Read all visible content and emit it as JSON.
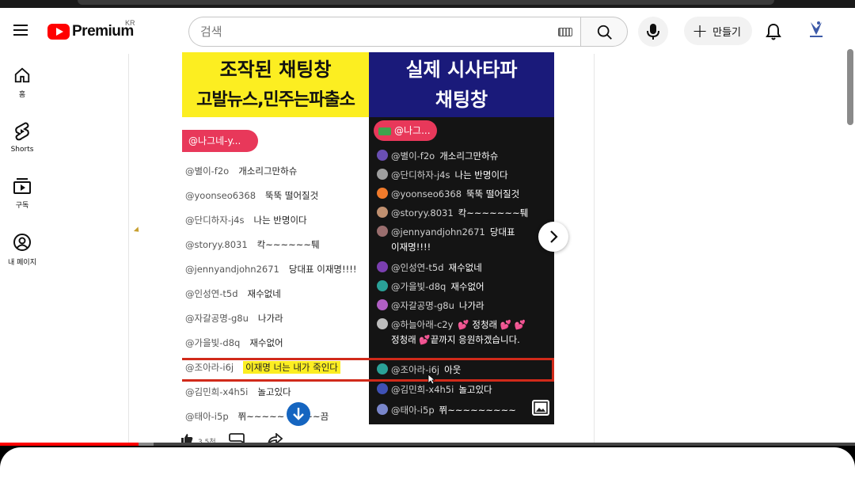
{
  "header": {
    "logo_text": "Premium",
    "region": "KR",
    "search_placeholder": "검색",
    "create_label": "만들기"
  },
  "nav": [
    {
      "label": "홈",
      "icon": "home-icon"
    },
    {
      "label": "Shorts",
      "icon": "shorts-icon"
    },
    {
      "label": "구독",
      "icon": "subscriptions-icon"
    },
    {
      "label": "내 페이지",
      "icon": "account-icon"
    }
  ],
  "post": {
    "left_title_1": "조작된 채팅창",
    "left_title_2": "고발뉴스,민주는파출소",
    "right_title_1": "실제 시사타파",
    "right_title_2": "채팅창",
    "left_pill": "@나그네-y...",
    "right_pill": "@나그...",
    "left_chat": [
      {
        "user": "@별이-f2o",
        "msg": "개소리그만하슈"
      },
      {
        "user": "@yoonseo6368",
        "msg": "뚝뚝 떨어질것"
      },
      {
        "user": "@단디하자-j4s",
        "msg": "나는 반명이다"
      },
      {
        "user": "@storyy.8031",
        "msg": "칵~~~~~~퉤"
      },
      {
        "user": "@jennyandjohn2671",
        "msg": "당대표 이재명!!!!"
      },
      {
        "user": "@인성연-t5d",
        "msg": "재수없네"
      },
      {
        "user": "@자갈공명-g8u",
        "msg": "나가라"
      },
      {
        "user": "@가을빛-d8q",
        "msg": "재수없어"
      },
      {
        "user": "@조아라-i6j",
        "msg": "이재명 너는 내가 죽인다"
      },
      {
        "user": "@김민희-x4h5i",
        "msg": "놀고있다"
      },
      {
        "user": "@태아-i5p",
        "msg": "쮜~~~~~",
        "msg2": "~~끔"
      }
    ],
    "right_chat": [
      {
        "user": "@별이-f2o",
        "msg": "개소리그만하슈",
        "color": "#6a4fb3"
      },
      {
        "user": "@단디하자-j4s",
        "msg": "나는 반명이다",
        "color": "#9e9e9e"
      },
      {
        "user": "@yoonseo6368",
        "msg": "뚝뚝 떨어질것",
        "color": "#f07a2b"
      },
      {
        "user": "@storyy.8031",
        "msg": "칵~~~~~~~퉤",
        "color": "#c09070"
      },
      {
        "user": "@jennyandjohn2671",
        "msg": "당대표",
        "msg_line2": "이재명!!!!",
        "color": "#9a6e6e"
      },
      {
        "user": "@인성연-t5d",
        "msg": "재수없네",
        "color": "#7b3fb0"
      },
      {
        "user": "@가을빛-d8q",
        "msg": "재수없어",
        "color": "#2aa198"
      },
      {
        "user": "@자갈공명-g8u",
        "msg": "나가라",
        "color": "#b05fc4"
      },
      {
        "user": "@하늘아래-c2y",
        "msg": "💕 정청래 💕 💕",
        "msg_line2": "정청래 💕끝까지 응원하겠습니다.",
        "color": "#bdbdbd"
      },
      {
        "user": "@조아라-i6j",
        "msg": "아웃",
        "color": "#2aa198"
      },
      {
        "user": "@김민희-x4h5i",
        "msg": "놀고있다",
        "color": "#3f51b5"
      },
      {
        "user": "@태아-i5p",
        "msg": "쮜~~~~~~~~~",
        "color": "#7986cb"
      }
    ],
    "like_count": "3.5천"
  },
  "progress": {
    "played": 0.162,
    "buffered": 0.18
  },
  "colors": {
    "accent": "#ff0000",
    "highlight": "#fcee21",
    "pill": "#e8385a",
    "border": "#d12a1a"
  }
}
